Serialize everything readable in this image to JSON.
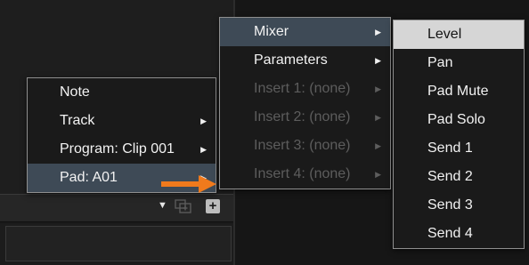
{
  "context_menu": {
    "items": [
      {
        "label": "Note",
        "has_submenu": false,
        "enabled": true
      },
      {
        "label": "Track",
        "has_submenu": true,
        "enabled": true
      },
      {
        "label": "Program: Clip 001",
        "has_submenu": true,
        "enabled": true
      },
      {
        "label": "Pad: A01",
        "has_submenu": true,
        "enabled": true,
        "active": true
      }
    ]
  },
  "pad_menu": {
    "items": [
      {
        "label": "Mixer",
        "has_submenu": true,
        "enabled": true,
        "active": true
      },
      {
        "label": "Parameters",
        "has_submenu": true,
        "enabled": true
      },
      {
        "label": "Insert 1: (none)",
        "has_submenu": true,
        "enabled": false
      },
      {
        "label": "Insert 2: (none)",
        "has_submenu": true,
        "enabled": false
      },
      {
        "label": "Insert 3: (none)",
        "has_submenu": true,
        "enabled": false
      },
      {
        "label": "Insert 4: (none)",
        "has_submenu": true,
        "enabled": false
      }
    ]
  },
  "mixer_menu": {
    "items": [
      {
        "label": "Level",
        "highlighted": true
      },
      {
        "label": "Pan"
      },
      {
        "label": "Pad Mute"
      },
      {
        "label": "Pad Solo"
      },
      {
        "label": "Send 1"
      },
      {
        "label": "Send 2"
      },
      {
        "label": "Send 3"
      },
      {
        "label": "Send 4"
      }
    ]
  },
  "toolbar": {
    "dropdown_icon": "triangle-down-icon",
    "duplicate_icon": "duplicate-icon",
    "add_icon": "plus-icon"
  },
  "annotation": {
    "arrow_icon": "orange-arrow-icon",
    "arrow_color": "#f07a1c"
  },
  "colors": {
    "menu_bg": "#1a1a1a",
    "menu_border": "#8f8f8f",
    "highlight_bg": "#d6d6d6",
    "disabled_text": "#5d5d5d"
  }
}
